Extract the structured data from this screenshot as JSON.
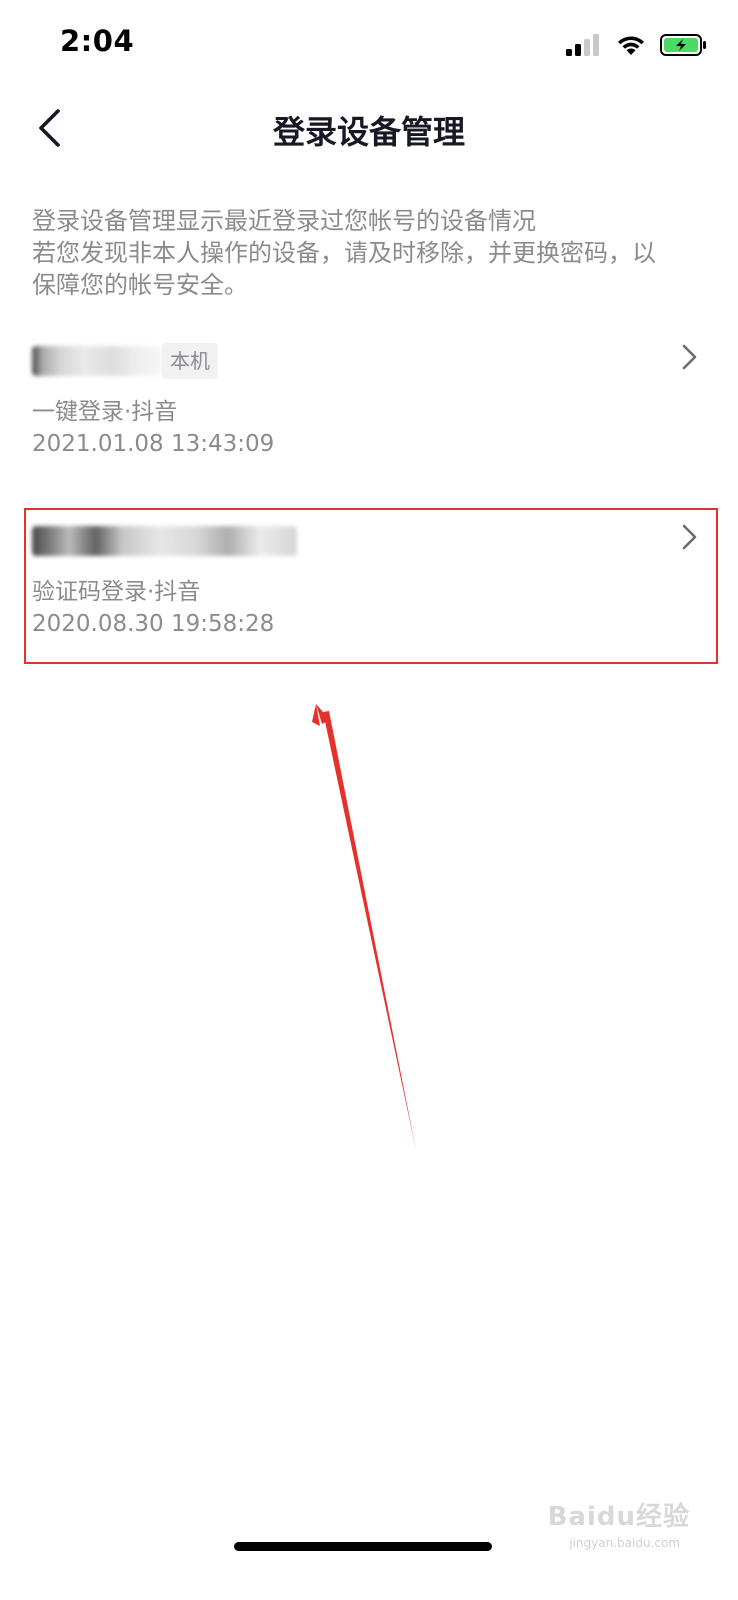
{
  "status_bar": {
    "time": "2:04"
  },
  "nav": {
    "title": "登录设备管理"
  },
  "intro": {
    "lines": [
      "登录设备管理显示最近登录过您帐号的设备情况",
      "若您发现非本人操作的设备，请及时移除，并更换密码，以",
      "保障您的帐号安全。"
    ]
  },
  "devices": [
    {
      "badge": "本机",
      "method": "一键登录·抖音",
      "time": "2021.01.08 13:43:09"
    },
    {
      "method": "验证码登录·抖音",
      "time": "2020.08.30 19:58:28"
    }
  ],
  "annotation": {
    "color": "#e5302c"
  },
  "watermark": {
    "text": "Baidu经验",
    "sub": "jingyan.baidu.com"
  },
  "colors": {
    "text_primary": "#161823",
    "text_secondary": "#8a8b91",
    "battery_green": "#4cd964"
  }
}
